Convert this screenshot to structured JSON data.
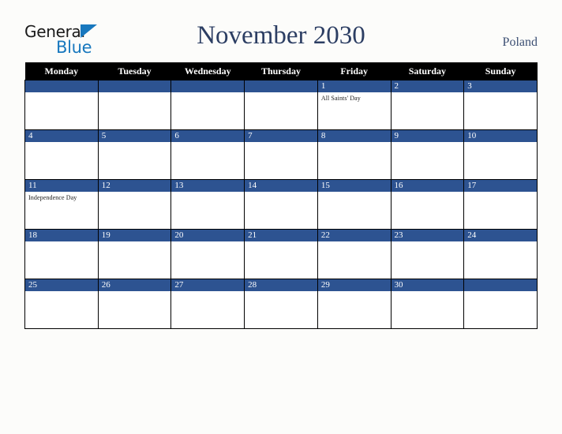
{
  "brand": {
    "name_part1": "General",
    "name_part2": "Blue",
    "triangle_icon": "triangle-icon",
    "colors": {
      "blue": "#1878be",
      "black": "#1a1a1a"
    }
  },
  "header": {
    "title": "November 2030",
    "country": "Poland",
    "title_color": "#2c3e63"
  },
  "calendar": {
    "month": "November",
    "year": "2030",
    "week_start": "Monday",
    "accent_color": "#2d5391",
    "header_bg": "#000000",
    "weekday_headers": [
      "Monday",
      "Tuesday",
      "Wednesday",
      "Thursday",
      "Friday",
      "Saturday",
      "Sunday"
    ],
    "weeks": [
      [
        {
          "day": "",
          "event": ""
        },
        {
          "day": "",
          "event": ""
        },
        {
          "day": "",
          "event": ""
        },
        {
          "day": "",
          "event": ""
        },
        {
          "day": "1",
          "event": "All Saints' Day"
        },
        {
          "day": "2",
          "event": ""
        },
        {
          "day": "3",
          "event": ""
        }
      ],
      [
        {
          "day": "4",
          "event": ""
        },
        {
          "day": "5",
          "event": ""
        },
        {
          "day": "6",
          "event": ""
        },
        {
          "day": "7",
          "event": ""
        },
        {
          "day": "8",
          "event": ""
        },
        {
          "day": "9",
          "event": ""
        },
        {
          "day": "10",
          "event": ""
        }
      ],
      [
        {
          "day": "11",
          "event": "Independence Day"
        },
        {
          "day": "12",
          "event": ""
        },
        {
          "day": "13",
          "event": ""
        },
        {
          "day": "14",
          "event": ""
        },
        {
          "day": "15",
          "event": ""
        },
        {
          "day": "16",
          "event": ""
        },
        {
          "day": "17",
          "event": ""
        }
      ],
      [
        {
          "day": "18",
          "event": ""
        },
        {
          "day": "19",
          "event": ""
        },
        {
          "day": "20",
          "event": ""
        },
        {
          "day": "21",
          "event": ""
        },
        {
          "day": "22",
          "event": ""
        },
        {
          "day": "23",
          "event": ""
        },
        {
          "day": "24",
          "event": ""
        }
      ],
      [
        {
          "day": "25",
          "event": ""
        },
        {
          "day": "26",
          "event": ""
        },
        {
          "day": "27",
          "event": ""
        },
        {
          "day": "28",
          "event": ""
        },
        {
          "day": "29",
          "event": ""
        },
        {
          "day": "30",
          "event": ""
        },
        {
          "day": "",
          "event": ""
        }
      ]
    ]
  }
}
